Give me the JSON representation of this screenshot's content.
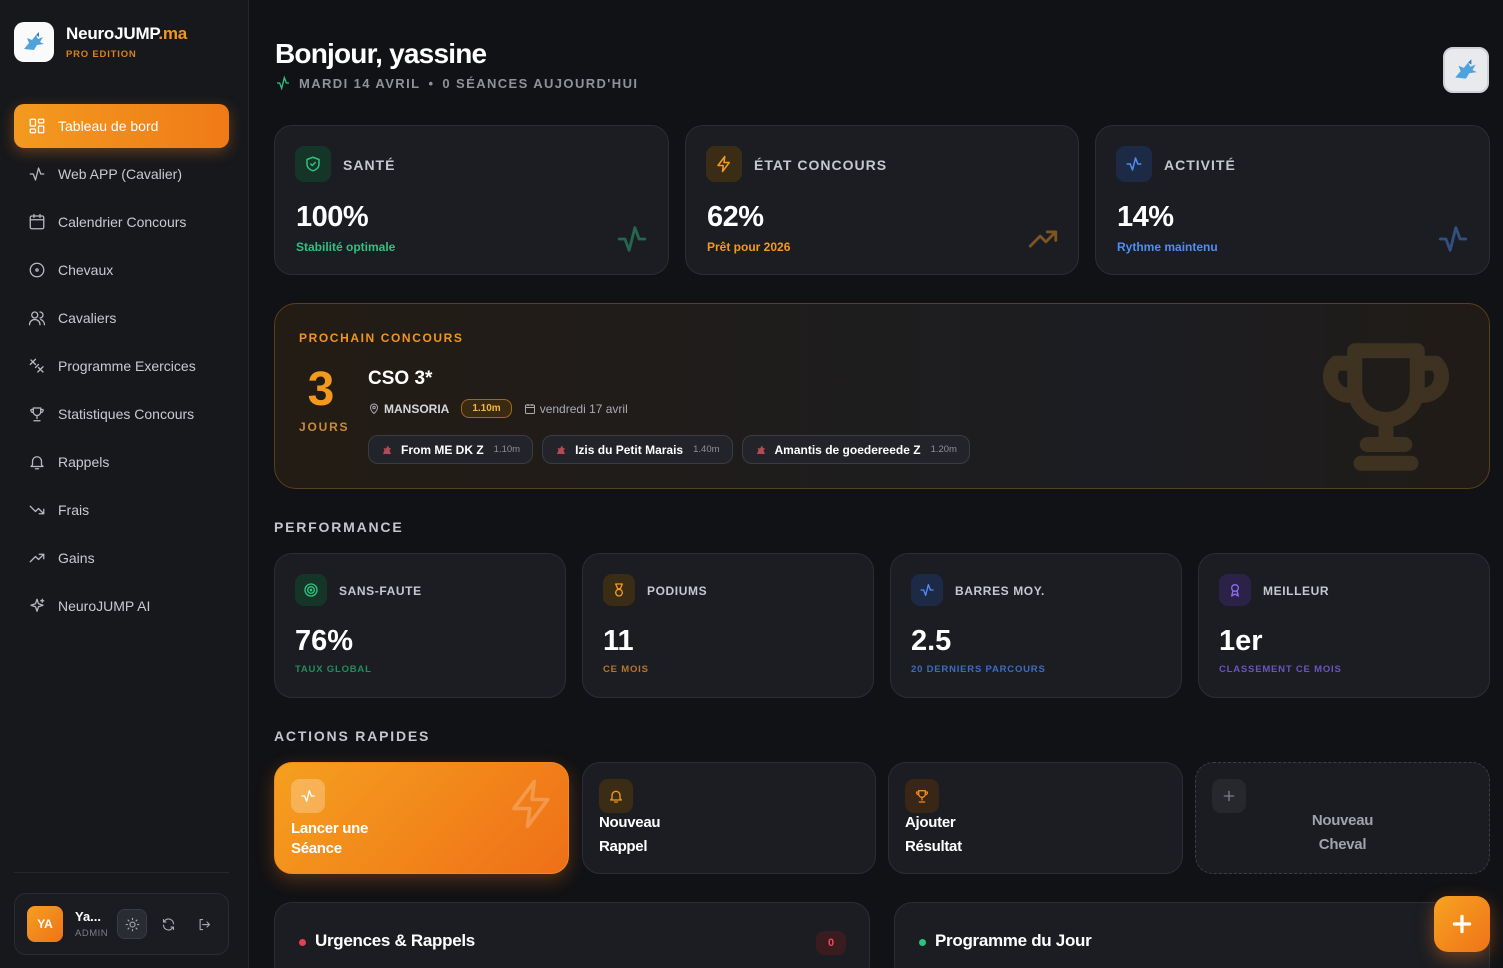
{
  "brand": {
    "name": "NeuroJUMP",
    "tld": ".ma",
    "edition": "PRO EDITION"
  },
  "sidebar": {
    "items": [
      {
        "label": "Tableau de bord",
        "icon": "dashboard-icon",
        "active": true
      },
      {
        "label": "Web APP (Cavalier)",
        "icon": "activity-icon"
      },
      {
        "label": "Calendrier Concours",
        "icon": "calendar-icon"
      },
      {
        "label": "Chevaux",
        "icon": "target-icon"
      },
      {
        "label": "Cavaliers",
        "icon": "users-icon"
      },
      {
        "label": "Programme Exercices",
        "icon": "tools-icon"
      },
      {
        "label": "Statistiques Concours",
        "icon": "trophy-icon"
      },
      {
        "label": "Rappels",
        "icon": "bell-icon"
      },
      {
        "label": "Frais",
        "icon": "trending-down-icon"
      },
      {
        "label": "Gains",
        "icon": "trending-up-icon"
      },
      {
        "label": "NeuroJUMP AI",
        "icon": "sparkles-icon"
      }
    ]
  },
  "user": {
    "initials": "YA",
    "name": "Ya...",
    "role": "ADMIN"
  },
  "header": {
    "greeting": "Bonjour, yassine",
    "date": "MARDI 14 AVRIL",
    "sessions": "0 SÉANCES AUJOURD'HUI"
  },
  "stats": [
    {
      "label": "SANTÉ",
      "value": "100%",
      "sub": "Stabilité optimale",
      "color": "#2ec27e",
      "icon": "shield-check-icon"
    },
    {
      "label": "ÉTAT CONCOURS",
      "value": "62%",
      "sub": "Prêt pour 2026",
      "color": "#f39a1e",
      "icon": "lightning-icon"
    },
    {
      "label": "ACTIVITÉ",
      "value": "14%",
      "sub": "Rythme maintenu",
      "color": "#4f8df5",
      "icon": "activity-icon"
    }
  ],
  "next_competition": {
    "label": "PROCHAIN CONCOURS",
    "days": "3",
    "days_label": "JOURS",
    "title": "CSO 3*",
    "location": "MANSORIA",
    "height": "1.10m",
    "date": "vendredi 17 avril",
    "horses": [
      {
        "name": "From ME DK Z",
        "height": "1.10m"
      },
      {
        "name": "Izis du Petit Marais",
        "height": "1.40m"
      },
      {
        "name": "Amantis de goedereede Z",
        "height": "1.20m"
      }
    ]
  },
  "performance": {
    "title": "PERFORMANCE",
    "items": [
      {
        "label": "SANS-FAUTE",
        "value": "76%",
        "sub": "TAUX GLOBAL",
        "color": "#2ec27e",
        "icon": "target-icon"
      },
      {
        "label": "PODIUMS",
        "value": "11",
        "sub": "CE MOIS",
        "color": "#f39a1e",
        "icon": "medal-icon"
      },
      {
        "label": "BARRES MOY.",
        "value": "2.5",
        "sub": "20 DERNIERS PARCOURS",
        "color": "#4f8df5",
        "icon": "activity-icon"
      },
      {
        "label": "MEILLEUR",
        "value": "1er",
        "sub": "CLASSEMENT CE MOIS",
        "color": "#8b6cf0",
        "icon": "award-icon"
      }
    ]
  },
  "actions": {
    "title": "ACTIONS RAPIDES",
    "items": [
      {
        "line1": "Lancer une",
        "line2": "Séance"
      },
      {
        "line1": "Nouveau",
        "line2": "Rappel"
      },
      {
        "line1": "Ajouter",
        "line2": "Résultat"
      },
      {
        "line1": "Nouveau",
        "line2": "Cheval"
      }
    ]
  },
  "bottom": {
    "urgences": {
      "title": "Urgences & Rappels",
      "count": "0",
      "color": "#e0424f"
    },
    "programme": {
      "title": "Programme du Jour",
      "color": "#2ec27e"
    }
  }
}
